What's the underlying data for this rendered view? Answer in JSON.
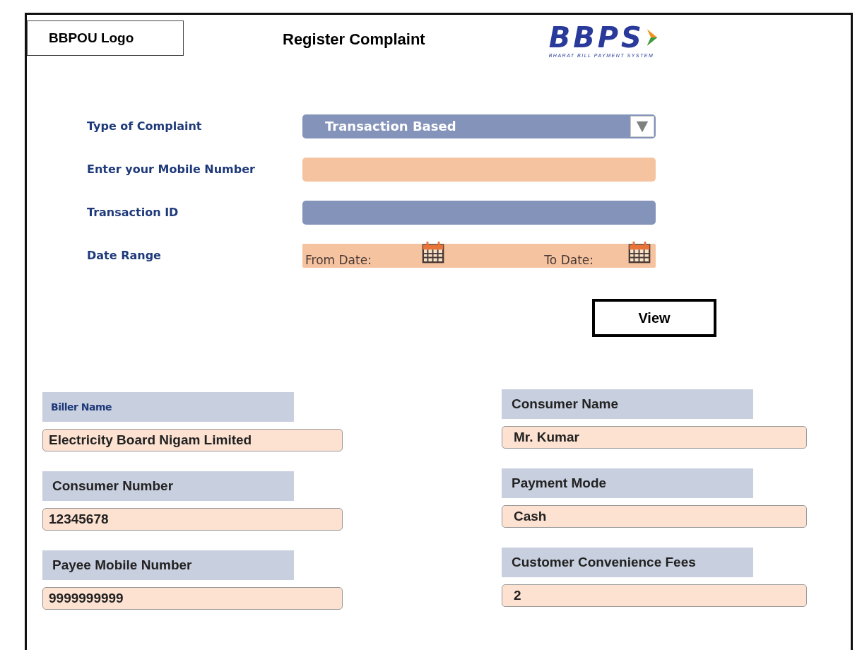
{
  "header": {
    "logo_placeholder": "BBPOU Logo",
    "title": "Register Complaint",
    "brand": {
      "name": "BBPS",
      "tagline": "BHARAT BILL PAYMENT SYSTEM"
    }
  },
  "form": {
    "fields": [
      {
        "kind": "dropdown",
        "label": "Type of Complaint",
        "value": "Transaction Based",
        "color": "#8493ba"
      },
      {
        "kind": "text",
        "label": "Enter your Mobile Number",
        "color": "#f6c3a0"
      },
      {
        "kind": "text",
        "label": "Transaction ID",
        "color": "#8493ba"
      },
      {
        "kind": "daterange",
        "label": "Date Range",
        "from_label": "From Date:",
        "to_label": "To Date:",
        "color": "#f6c3a0"
      }
    ],
    "button": "View"
  },
  "details": {
    "columns": [
      [
        {
          "label": "Biller Name",
          "kind": "caption",
          "value": "Electricity Board Nigam Limited"
        },
        {
          "label": "Consumer Number",
          "kind": "heading",
          "value": "12345678"
        },
        {
          "label": "Payee Mobile Number",
          "kind": "heading",
          "value": "9999999999"
        }
      ],
      [
        {
          "label": "Consumer Name",
          "kind": "heading",
          "value": "Mr. Kumar"
        },
        {
          "label": "Payment Mode",
          "kind": "heading",
          "value": "Cash"
        },
        {
          "label": "Customer Convenience Fees",
          "kind": "heading",
          "value": "2"
        }
      ]
    ]
  }
}
